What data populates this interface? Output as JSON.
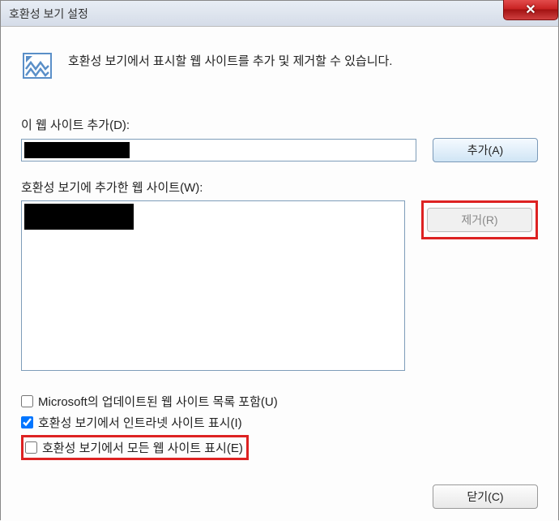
{
  "titlebar": {
    "title": "호환성 보기 설정"
  },
  "header": {
    "description": "호환성 보기에서 표시할 웹 사이트를 추가 및 제거할 수 있습니다."
  },
  "addSection": {
    "label": "이 웹 사이트 추가(D):",
    "addButton": "추가(A)"
  },
  "listSection": {
    "label": "호환성 보기에 추가한 웹 사이트(W):",
    "removeButton": "제거(R)"
  },
  "checkboxes": {
    "msUpdates": {
      "label": "Microsoft의 업데이트된 웹 사이트 목록 포함(U)",
      "checked": false
    },
    "intranet": {
      "label": "호환성 보기에서 인트라넷 사이트 표시(I)",
      "checked": true
    },
    "allSites": {
      "label": "호환성 보기에서 모든 웹 사이트 표시(E)",
      "checked": false
    }
  },
  "footer": {
    "closeButton": "닫기(C)"
  }
}
